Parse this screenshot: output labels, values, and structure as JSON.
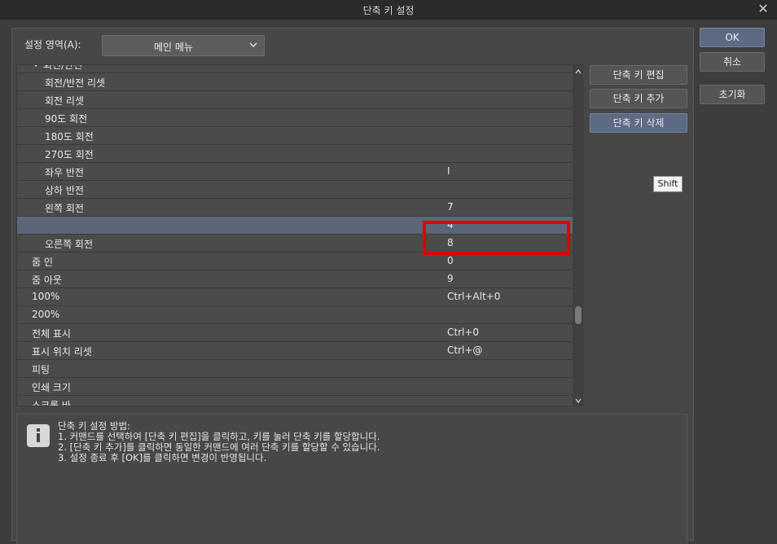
{
  "window": {
    "title": "단축 키 설정"
  },
  "area": {
    "label": "설정 영역(A):",
    "selected": "메인 메뉴"
  },
  "rows": [
    {
      "name": "회전/반전",
      "key": "",
      "indent": 1,
      "expanded": true
    },
    {
      "name": "회전/반전 리셋",
      "key": "",
      "indent": 2
    },
    {
      "name": "회전 리셋",
      "key": "",
      "indent": 2
    },
    {
      "name": "90도 회전",
      "key": "",
      "indent": 2
    },
    {
      "name": "180도 회전",
      "key": "",
      "indent": 2
    },
    {
      "name": "270도 회전",
      "key": "",
      "indent": 2
    },
    {
      "name": "좌우 반전",
      "key": "I",
      "indent": 2
    },
    {
      "name": "상하 반전",
      "key": "",
      "indent": 2
    },
    {
      "name": "왼쪽 회전",
      "key": "7",
      "indent": 2
    },
    {
      "name": "",
      "key": "4",
      "indent": 2,
      "selected": true
    },
    {
      "name": "오른쪽 회전",
      "key": "8",
      "indent": 2
    },
    {
      "name": "줌 인",
      "key": "0",
      "indent": 1
    },
    {
      "name": "줌 아웃",
      "key": "9",
      "indent": 1
    },
    {
      "name": "100%",
      "key": "Ctrl+Alt+0",
      "indent": 1
    },
    {
      "name": "200%",
      "key": "",
      "indent": 1
    },
    {
      "name": "전체 표시",
      "key": "Ctrl+0",
      "indent": 1
    },
    {
      "name": "표시 위치 리셋",
      "key": "Ctrl+@",
      "indent": 1
    },
    {
      "name": "피팅",
      "key": "",
      "indent": 1
    },
    {
      "name": "인쇄 크기",
      "key": "",
      "indent": 1
    },
    {
      "name": "스크롤 바",
      "key": "",
      "indent": 1
    }
  ],
  "side_buttons": {
    "edit": "단축 키 편집",
    "add": "단축 키 추가",
    "delete": "단축 키 삭제"
  },
  "tooltip": "Shift",
  "help": {
    "title": "단축 키 설정 방법:",
    "lines": [
      "1. 커맨드를 선택하여 [단축 키 편집]을 클릭하고, 키를 눌러 단축 키를 할당합니다.",
      "2. [단축 키 추가]를 클릭하면 동일한 커맨드에 여러 단축 키를 할당할 수 있습니다.",
      "3. 설정 종료 후 [OK]를 클릭하면 변경이 반영됩니다."
    ]
  },
  "right_buttons": {
    "ok": "OK",
    "cancel": "취소",
    "reset": "초기화"
  },
  "colors": {
    "accent": "#5d6a84",
    "highlight": "#e00000",
    "selected_row": "#5d6678"
  },
  "scroll": {
    "position": 0.72
  }
}
